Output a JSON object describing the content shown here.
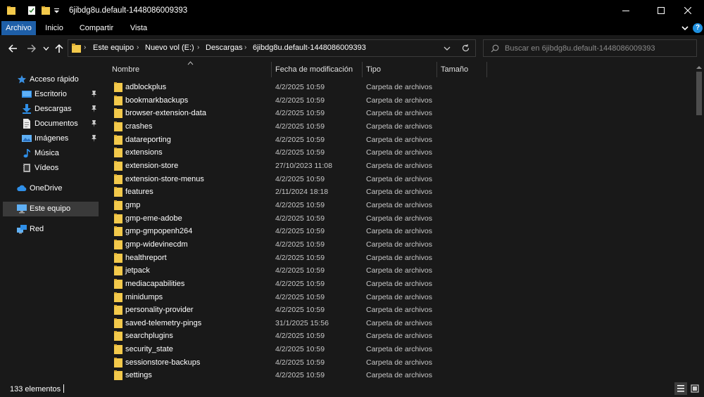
{
  "window": {
    "title": "6jibdg8u.default-1448086009393"
  },
  "ribbon": {
    "tabs": [
      {
        "label": "Archivo",
        "active": true
      },
      {
        "label": "Inicio",
        "active": false
      },
      {
        "label": "Compartir",
        "active": false
      },
      {
        "label": "Vista",
        "active": false
      }
    ],
    "help": "?"
  },
  "address": {
    "crumbs": [
      "Este equipo",
      "Nuevo vol (E:)",
      "Descargas",
      "6jibdg8u.default-1448086009393"
    ]
  },
  "search": {
    "placeholder": "Buscar en 6jibdg8u.default-1448086009393",
    "value": ""
  },
  "nav": {
    "items": [
      {
        "label": "Acceso rápido",
        "icon": "star-icon",
        "pinned": false,
        "selected": false
      },
      {
        "label": "Escritorio",
        "icon": "desktop-icon",
        "pinned": true,
        "selected": false
      },
      {
        "label": "Descargas",
        "icon": "download-icon",
        "pinned": true,
        "selected": false
      },
      {
        "label": "Documentos",
        "icon": "document-icon",
        "pinned": true,
        "selected": false
      },
      {
        "label": "Imágenes",
        "icon": "pictures-icon",
        "pinned": true,
        "selected": false
      },
      {
        "label": "Música",
        "icon": "music-icon",
        "pinned": false,
        "selected": false
      },
      {
        "label": "Vídeos",
        "icon": "videos-icon",
        "pinned": false,
        "selected": false
      },
      {
        "label": "OneDrive",
        "icon": "cloud-icon",
        "pinned": false,
        "selected": false
      },
      {
        "label": "Este equipo",
        "icon": "computer-icon",
        "pinned": false,
        "selected": true
      },
      {
        "label": "Red",
        "icon": "network-icon",
        "pinned": false,
        "selected": false
      }
    ]
  },
  "columns": {
    "name": "Nombre",
    "date": "Fecha de modificación",
    "type": "Tipo",
    "size": "Tamaño"
  },
  "files": [
    {
      "name": "adblockplus",
      "date": "4/2/2025 10:59",
      "type": "Carpeta de archivos"
    },
    {
      "name": "bookmarkbackups",
      "date": "4/2/2025 10:59",
      "type": "Carpeta de archivos"
    },
    {
      "name": "browser-extension-data",
      "date": "4/2/2025 10:59",
      "type": "Carpeta de archivos"
    },
    {
      "name": "crashes",
      "date": "4/2/2025 10:59",
      "type": "Carpeta de archivos"
    },
    {
      "name": "datareporting",
      "date": "4/2/2025 10:59",
      "type": "Carpeta de archivos"
    },
    {
      "name": "extensions",
      "date": "4/2/2025 10:59",
      "type": "Carpeta de archivos"
    },
    {
      "name": "extension-store",
      "date": "27/10/2023 11:08",
      "type": "Carpeta de archivos"
    },
    {
      "name": "extension-store-menus",
      "date": "4/2/2025 10:59",
      "type": "Carpeta de archivos"
    },
    {
      "name": "features",
      "date": "2/11/2024 18:18",
      "type": "Carpeta de archivos"
    },
    {
      "name": "gmp",
      "date": "4/2/2025 10:59",
      "type": "Carpeta de archivos"
    },
    {
      "name": "gmp-eme-adobe",
      "date": "4/2/2025 10:59",
      "type": "Carpeta de archivos"
    },
    {
      "name": "gmp-gmpopenh264",
      "date": "4/2/2025 10:59",
      "type": "Carpeta de archivos"
    },
    {
      "name": "gmp-widevinecdm",
      "date": "4/2/2025 10:59",
      "type": "Carpeta de archivos"
    },
    {
      "name": "healthreport",
      "date": "4/2/2025 10:59",
      "type": "Carpeta de archivos"
    },
    {
      "name": "jetpack",
      "date": "4/2/2025 10:59",
      "type": "Carpeta de archivos"
    },
    {
      "name": "mediacapabilities",
      "date": "4/2/2025 10:59",
      "type": "Carpeta de archivos"
    },
    {
      "name": "minidumps",
      "date": "4/2/2025 10:59",
      "type": "Carpeta de archivos"
    },
    {
      "name": "personality-provider",
      "date": "4/2/2025 10:59",
      "type": "Carpeta de archivos"
    },
    {
      "name": "saved-telemetry-pings",
      "date": "31/1/2025 15:56",
      "type": "Carpeta de archivos"
    },
    {
      "name": "searchplugins",
      "date": "4/2/2025 10:59",
      "type": "Carpeta de archivos"
    },
    {
      "name": "security_state",
      "date": "4/2/2025 10:59",
      "type": "Carpeta de archivos"
    },
    {
      "name": "sessionstore-backups",
      "date": "4/2/2025 10:59",
      "type": "Carpeta de archivos"
    },
    {
      "name": "settings",
      "date": "4/2/2025 10:59",
      "type": "Carpeta de archivos"
    }
  ],
  "status": {
    "count": "133 elementos"
  },
  "colors": {
    "folder": "#f3c94b",
    "accent": "#1e5fa8",
    "background": "#191919",
    "titlebar": "#000000"
  }
}
